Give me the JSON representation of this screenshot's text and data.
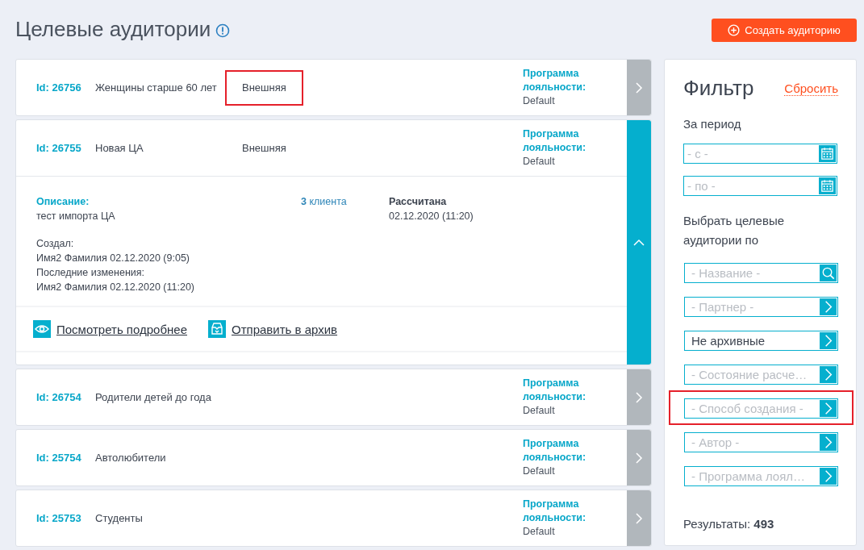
{
  "header": {
    "title": "Целевые аудитории",
    "create_button": "Создать аудиторию"
  },
  "audiences": [
    {
      "id": "Id: 26756",
      "name": "Женщины старше 60 лет",
      "type": "Внешняя",
      "type_highlighted": true,
      "loyalty_label": "Программа лояльности:",
      "loyalty_value": "Default",
      "expanded": false
    },
    {
      "id": "Id: 26755",
      "name": "Новая ЦА",
      "type": "Внешняя",
      "type_highlighted": false,
      "loyalty_label": "Программа лояльности:",
      "loyalty_value": "Default",
      "expanded": true,
      "details": {
        "description_label": "Описание:",
        "description": "тест импорта ЦА",
        "clients": "**3** клиента",
        "status_label": "Рассчитана",
        "status_date": "02.12.2020 (11:20)",
        "created_label": "Создал:",
        "created": "Имя2 Фамилия  02.12.2020 (9:05)",
        "modified_label": "Последние изменения:",
        "modified": "Имя2 Фамилия  02.12.2020 (11:20)",
        "view_link": "Посмотреть подробнее ",
        "archive_link": "Отправить в архив"
      }
    },
    {
      "id": "Id: 26754",
      "name": "Родители детей до года",
      "loyalty_label": "Программа лояльности:",
      "loyalty_value": "Default",
      "expanded": false
    },
    {
      "id": "Id: 25754",
      "name": "Автолюбители",
      "loyalty_label": "Программа лояльности:",
      "loyalty_value": "Default",
      "expanded": false
    },
    {
      "id": "Id: 25753",
      "name": "Студенты",
      "loyalty_label": "Программа лояльности:",
      "loyalty_value": "Default",
      "expanded": false
    }
  ],
  "filter": {
    "title": "Фильтр",
    "reset": "Сбросить",
    "period_label": "За период",
    "date_fields": [
      {
        "placeholder": "- с -"
      },
      {
        "placeholder": "- по -"
      }
    ],
    "select_label": "Выбрать целевые аудитории по",
    "fields": [
      {
        "kind": "search",
        "placeholder": "- Название -",
        "highlighted": false
      },
      {
        "kind": "select",
        "placeholder": "- Партнер -",
        "highlighted": false
      },
      {
        "kind": "select",
        "value": "Не архивные",
        "highlighted": false
      },
      {
        "kind": "select",
        "placeholder": "- Состояние расче…",
        "highlighted": false
      },
      {
        "kind": "select",
        "placeholder": "- Способ создания -",
        "highlighted": true
      },
      {
        "kind": "select",
        "placeholder": "- Автор -",
        "highlighted": false
      },
      {
        "kind": "select",
        "placeholder": "- Программа лоял…",
        "highlighted": false
      }
    ],
    "results": "Результаты: **493**"
  }
}
